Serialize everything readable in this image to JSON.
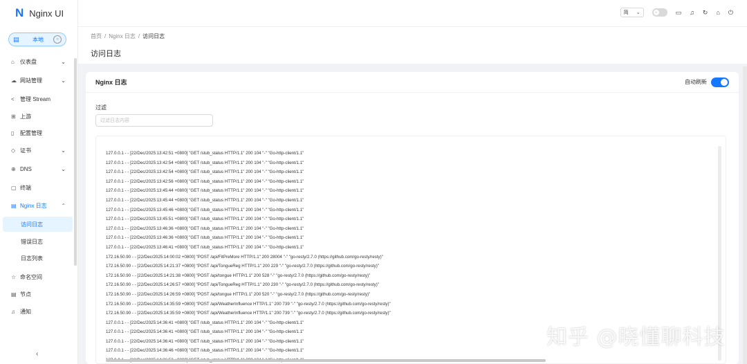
{
  "app": {
    "logo_letter": "N",
    "title": "Nginx UI"
  },
  "node": {
    "label": "本地"
  },
  "menu": {
    "items": [
      {
        "icon": "⌂",
        "label": "仪表盘",
        "chev": "⌄"
      },
      {
        "icon": "☁",
        "label": "网站管理",
        "chev": "⌄"
      },
      {
        "icon": "<",
        "label": "管理 Stream"
      },
      {
        "icon": "⊞",
        "label": "上游"
      },
      {
        "icon": "▯",
        "label": "配置管理"
      },
      {
        "icon": "◇",
        "label": "证书",
        "chev": "⌄"
      },
      {
        "icon": "⊕",
        "label": "DNS",
        "chev": "⌄"
      },
      {
        "icon": "▢",
        "label": "终端"
      },
      {
        "icon": "▤",
        "label": "Nginx 日志",
        "chev": "⌃"
      },
      {
        "label": "访问日志"
      },
      {
        "label": "错误日志"
      },
      {
        "label": "日志列表"
      },
      {
        "icon": "☆",
        "label": "命名空间"
      },
      {
        "icon": "▤",
        "label": "节点"
      },
      {
        "icon": "♫",
        "label": "通知"
      }
    ],
    "collapse_icon": "‹"
  },
  "header": {
    "lang": "简",
    "icons": [
      "monitor-icon",
      "bell-icon",
      "reload-icon",
      "home-icon",
      "logout-icon"
    ]
  },
  "breadcrumb": {
    "home": "首页",
    "logs": "Nginx 日志",
    "current": "访问日志"
  },
  "page": {
    "title": "访问日志"
  },
  "card": {
    "title": "Nginx 日志",
    "auto_refresh_label": "自动刷新",
    "auto_refresh": true
  },
  "filter": {
    "label": "过滤",
    "placeholder": "过滤日志内容",
    "value": ""
  },
  "log_lines": [
    "127.0.0.1 - - [22/Dec/2025:13:42:51 +0800] \"GET /stub_status HTTP/1.1\" 200 104 \"-\" \"Go-http-client/1.1\"",
    "127.0.0.1 - - [22/Dec/2025:13:42:54 +0800] \"GET /stub_status HTTP/1.1\" 200 104 \"-\" \"Go-http-client/1.1\"",
    "127.0.0.1 - - [22/Dec/2025:13:42:54 +0800] \"GET /stub_status HTTP/1.1\" 200 104 \"-\" \"Go-http-client/1.1\"",
    "127.0.0.1 - - [22/Dec/2025:13:42:56 +0800] \"GET /stub_status HTTP/1.1\" 200 104 \"-\" \"Go-http-client/1.1\"",
    "127.0.0.1 - - [22/Dec/2025:13:45:44 +0800] \"GET /stub_status HTTP/1.1\" 200 104 \"-\" \"Go-http-client/1.1\"",
    "127.0.0.1 - - [22/Dec/2025:13:45:44 +0800] \"GET /stub_status HTTP/1.1\" 200 104 \"-\" \"Go-http-client/1.1\"",
    "127.0.0.1 - - [22/Dec/2025:13:45:46 +0800] \"GET /stub_status HTTP/1.1\" 200 104 \"-\" \"Go-http-client/1.1\"",
    "127.0.0.1 - - [22/Dec/2025:13:45:51 +0800] \"GET /stub_status HTTP/1.1\" 200 104 \"-\" \"Go-http-client/1.1\"",
    "127.0.0.1 - - [22/Dec/2025:13:46:36 +0800] \"GET /stub_status HTTP/1.1\" 200 104 \"-\" \"Go-http-client/1.1\"",
    "127.0.0.1 - - [22/Dec/2025:13:46:36 +0800] \"GET /stub_status HTTP/1.1\" 200 104 \"-\" \"Go-http-client/1.1\"",
    "127.0.0.1 - - [22/Dec/2025:13:46:41 +0800] \"GET /stub_status HTTP/1.1\" 200 104 \"-\" \"Go-http-client/1.1\"",
    "172.16.50.90 - - [22/Dec/2025:14:00:02 +0800] \"POST /api/FitPreMore HTTP/1.1\" 200 28004 \"-\" \"go-resty/2.7.0 (https://github.com/go-resty/resty)\"",
    "172.16.50.90 - - [22/Dec/2025:14:21:37 +0800] \"POST /api/TongueReg HTTP/1.1\" 200 229 \"-\" \"go-resty/2.7.0 (https://github.com/go-resty/resty)\"",
    "172.16.50.90 - - [22/Dec/2025:14:21:38 +0800] \"POST /api/tongue HTTP/1.1\" 200 528 \"-\" \"go-resty/2.7.0 (https://github.com/go-resty/resty)\"",
    "172.16.50.90 - - [22/Dec/2025:14:26:57 +0800] \"POST /api/TongueReg HTTP/1.1\" 200 230 \"-\" \"go-resty/2.7.0 (https://github.com/go-resty/resty)\"",
    "172.16.50.90 - - [22/Dec/2025:14:26:59 +0800] \"POST /api/tongue HTTP/1.1\" 200 520 \"-\" \"go-resty/2.7.0 (https://github.com/go-resty/resty)\"",
    "172.16.50.90 - - [22/Dec/2025:14:35:59 +0800] \"POST /api/WeatherInfluence HTTP/1.1\" 200 739 \"-\" \"go-resty/2.7.0 (https://github.com/go-resty/resty)\"",
    "172.16.50.90 - - [22/Dec/2025:14:35:59 +0800] \"POST /api/WeatherInfluence HTTP/1.1\" 200 739 \"-\" \"go-resty/2.7.0 (https://github.com/go-resty/resty)\"",
    "127.0.0.1 - - [22/Dec/2025:14:36:41 +0800] \"GET /stub_status HTTP/1.1\" 200 104 \"-\" \"Go-http-client/1.1\"",
    "127.0.0.1 - - [22/Dec/2025:14:36:41 +0800] \"GET /stub_status HTTP/1.1\" 200 104 \"-\" \"Go-http-client/1.1\"",
    "127.0.0.1 - - [22/Dec/2025:14:36:41 +0800] \"GET /stub_status HTTP/1.1\" 200 104 \"-\" \"Go-http-client/1.1\"",
    "127.0.0.1 - - [22/Dec/2025:14:36:46 +0800] \"GET /stub_status HTTP/1.1\" 200 104 \"-\" \"Go-http-client/1.1\"",
    "127.0.0.1 - - [22/Dec/2025:14:36:53 +0800] \"GET /stub_status HTTP/1.1\" 200 104 \"-\" \"Go-http-client/1.1\""
  ],
  "watermark": "知乎 @晓懂聊科技"
}
